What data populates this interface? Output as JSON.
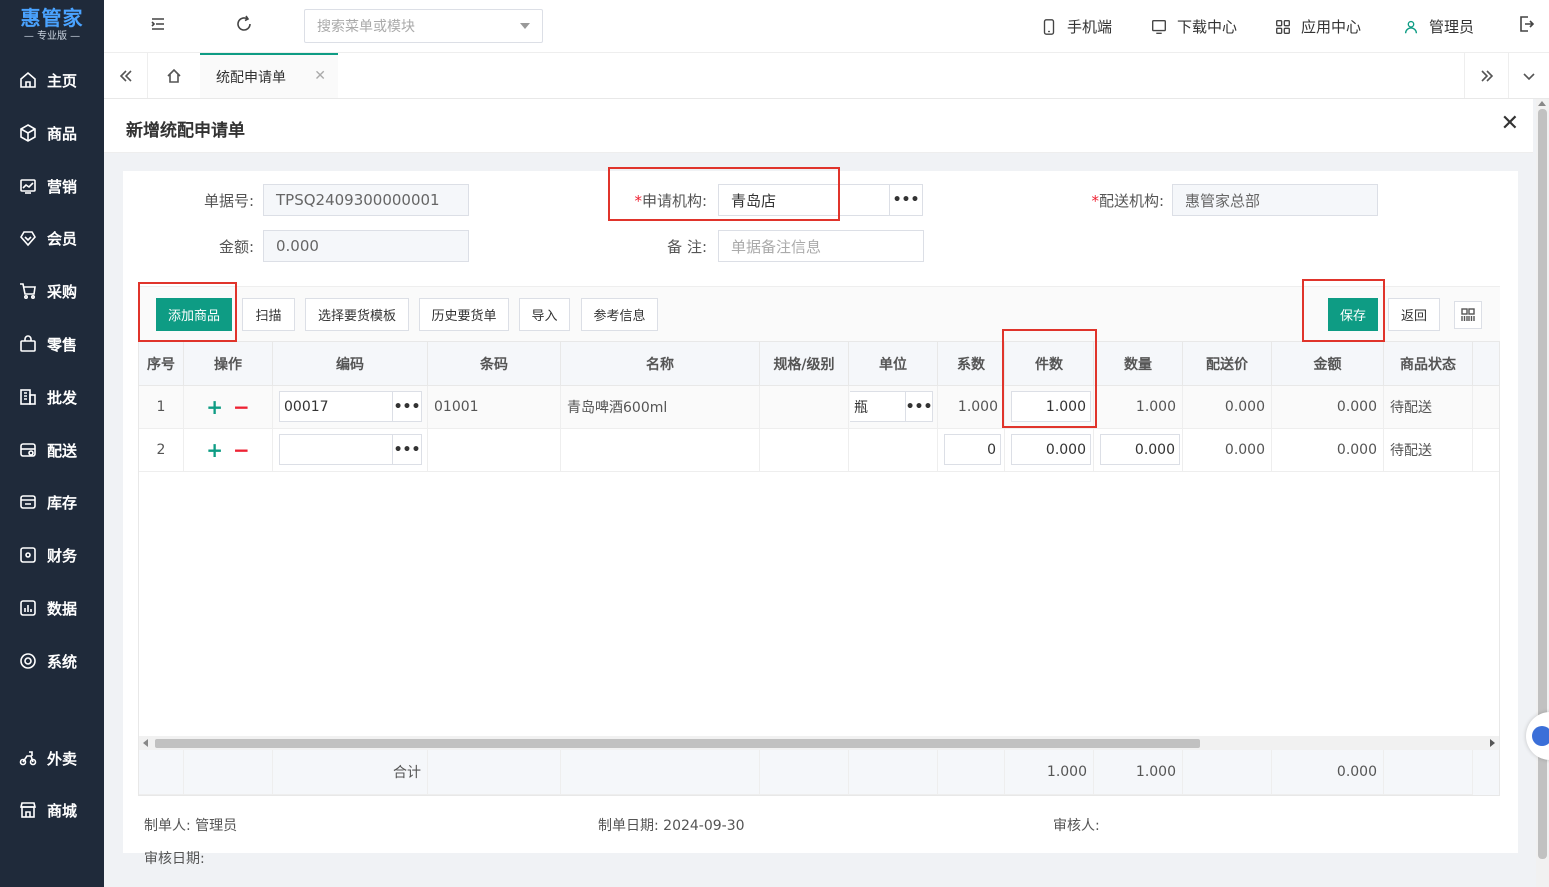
{
  "brand": {
    "name": "惠管家",
    "edition": "专业版"
  },
  "sidebar": {
    "items": [
      {
        "label": "主页",
        "icon": "home-icon"
      },
      {
        "label": "商品",
        "icon": "box-icon"
      },
      {
        "label": "营销",
        "icon": "chart-icon"
      },
      {
        "label": "会员",
        "icon": "diamond-icon"
      },
      {
        "label": "采购",
        "icon": "cart-icon"
      },
      {
        "label": "零售",
        "icon": "bag-icon"
      },
      {
        "label": "批发",
        "icon": "building-icon"
      },
      {
        "label": "配送",
        "icon": "truck-icon"
      },
      {
        "label": "库存",
        "icon": "warehouse-icon"
      },
      {
        "label": "财务",
        "icon": "finance-icon"
      },
      {
        "label": "数据",
        "icon": "data-icon"
      },
      {
        "label": "系统",
        "icon": "settings-icon"
      },
      {
        "label": "外卖",
        "icon": "scooter-icon"
      },
      {
        "label": "商城",
        "icon": "store-icon"
      }
    ]
  },
  "topbar": {
    "search_placeholder": "搜索菜单或模块",
    "mobile": "手机端",
    "download": "下载中心",
    "apps": "应用中心",
    "user": "管理员"
  },
  "tabs": {
    "active": "统配申请单"
  },
  "page": {
    "title": "新增统配申请单"
  },
  "form": {
    "doc_no_label": "单据号:",
    "doc_no": "TPSQ2409300000001",
    "amount_label": "金额:",
    "amount": "0.000",
    "apply_org_label": "申请机构:",
    "apply_org": "青岛店",
    "remark_label": "备 注:",
    "remark_placeholder": "单据备注信息",
    "dispatch_org_label": "配送机构:",
    "dispatch_org": "惠管家总部",
    "required_mark": "*",
    "dots": "•••"
  },
  "toolbar": {
    "add": "添加商品",
    "scan": "扫描",
    "template": "选择要货模板",
    "history": "历史要货单",
    "import": "导入",
    "reference": "参考信息",
    "save": "保存",
    "back": "返回"
  },
  "table": {
    "columns": [
      "序号",
      "操作",
      "编码",
      "条码",
      "名称",
      "规格/级别",
      "单位",
      "系数",
      "件数",
      "数量",
      "配送价",
      "金额",
      "商品状态"
    ],
    "rows": [
      {
        "index": "1",
        "code": "00017",
        "barcode": "01001",
        "name": "青岛啤酒600ml",
        "spec": "",
        "unit": "瓶",
        "coef": "1.000",
        "pieces": "1.000",
        "qty": "1.000",
        "price": "0.000",
        "amount": "0.000",
        "status": "待配送"
      },
      {
        "index": "2",
        "code": "",
        "barcode": "",
        "name": "",
        "spec": "",
        "unit": "",
        "coef": "0",
        "pieces": "0.000",
        "qty": "0.000",
        "price": "0.000",
        "amount": "0.000",
        "status": "待配送"
      }
    ],
    "footer": {
      "label": "合计",
      "pieces": "1.000",
      "qty": "1.000",
      "amount": "0.000"
    },
    "plus": "+",
    "minus": "−"
  },
  "footer": {
    "creator": "制单人: 管理员",
    "create_date": "制单日期: 2024-09-30",
    "auditor": "审核人:",
    "audit_date": "审核日期:"
  }
}
